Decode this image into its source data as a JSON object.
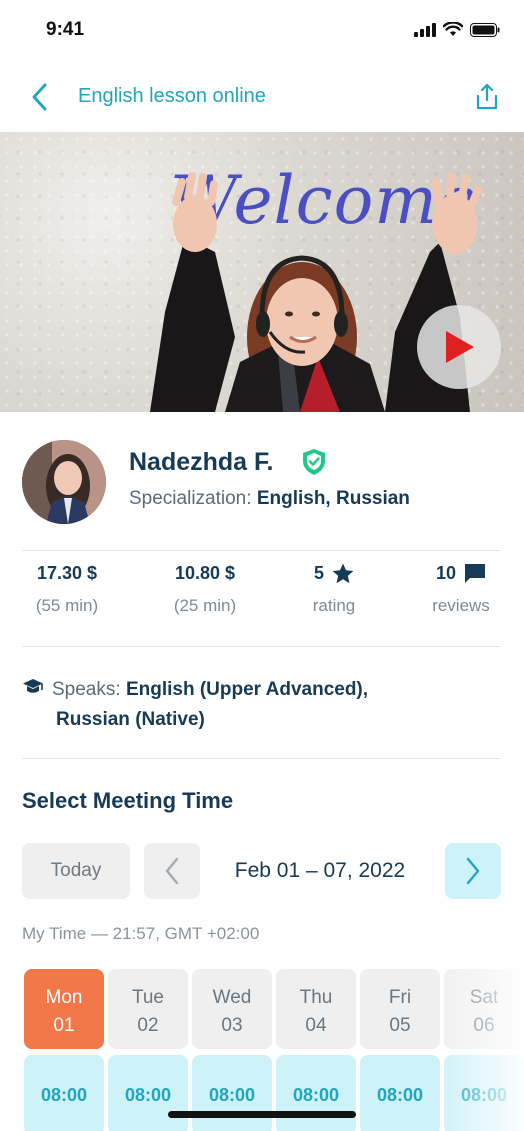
{
  "status": {
    "time": "9:41"
  },
  "nav": {
    "title": "English lesson online",
    "back_icon": "chevron-left-icon",
    "share_icon": "share-icon"
  },
  "video": {
    "welcome_text": "Welcome",
    "play_icon": "play-icon"
  },
  "profile": {
    "name": "Nadezhda F.",
    "verified_icon": "shield-check-icon",
    "specialization_label": "Specialization:",
    "specialization_value": "English, Russian"
  },
  "stats": [
    {
      "value": "17.30 $",
      "label": "(55 min)"
    },
    {
      "value": "10.80 $",
      "label": "(25 min)"
    },
    {
      "value": "5",
      "label": "rating",
      "icon": "star-icon"
    },
    {
      "value": "10",
      "label": "reviews",
      "icon": "comment-icon"
    }
  ],
  "speaks": {
    "label": "Speaks:",
    "line1": "English (Upper Advanced),",
    "line2": "Russian (Native)",
    "icon": "graduation-cap-icon"
  },
  "meeting": {
    "title": "Select Meeting Time",
    "today_label": "Today",
    "date_range": "Feb 01 – 07, 2022",
    "my_time": "My Time — 21:57, GMT +02:00"
  },
  "days": [
    {
      "name": "Mon",
      "num": "01",
      "slot": "08:00"
    },
    {
      "name": "Tue",
      "num": "02",
      "slot": "08:00"
    },
    {
      "name": "Wed",
      "num": "03",
      "slot": "08:00"
    },
    {
      "name": "Thu",
      "num": "04",
      "slot": "08:00"
    },
    {
      "name": "Fri",
      "num": "05",
      "slot": "08:00"
    },
    {
      "name": "Sat",
      "num": "06",
      "slot": "08:00"
    }
  ],
  "colors": {
    "accent": "#21a6bf",
    "active_day": "#f2784a",
    "slot_bg": "#cdf2f8",
    "text_dark": "#173b57"
  }
}
